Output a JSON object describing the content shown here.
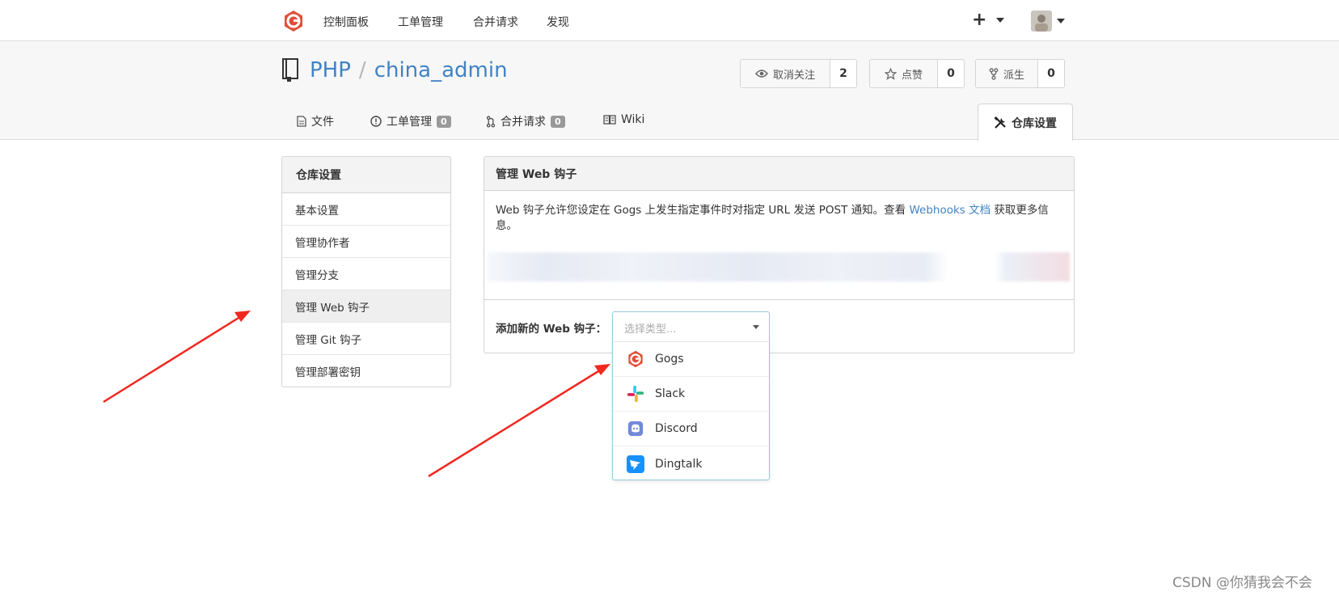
{
  "nav": {
    "items": [
      "控制面板",
      "工单管理",
      "合并请求",
      "发现"
    ],
    "plus": "+",
    "colors": {
      "logo": "#e04e39"
    }
  },
  "repo": {
    "owner": "PHP",
    "separator": "/",
    "name": "china_admin",
    "watch": {
      "label": "取消关注",
      "count": "2"
    },
    "star": {
      "label": "点赞",
      "count": "0"
    },
    "fork": {
      "label": "派生",
      "count": "0"
    }
  },
  "tabs": [
    {
      "label": "文件",
      "icon": "file-icon"
    },
    {
      "label": "工单管理",
      "icon": "issue-icon",
      "badge": "0"
    },
    {
      "label": "合并请求",
      "icon": "pull-request-icon",
      "badge": "0"
    },
    {
      "label": "Wiki",
      "icon": "book-icon"
    }
  ],
  "active_tab": {
    "label": "仓库设置",
    "icon": "tools-icon"
  },
  "sidebar": {
    "title": "仓库设置",
    "items": [
      "基本设置",
      "管理协作者",
      "管理分支",
      "管理 Web 钩子",
      "管理 Git 钩子",
      "管理部署密钥"
    ],
    "active_index": 3
  },
  "panel": {
    "title": "管理 Web 钩子",
    "desc_prefix": "Web 钩子允许您设定在 Gogs 上发生指定事件时对指定 URL 发送 POST 通知。查看 ",
    "desc_link": "Webhooks 文档",
    "desc_suffix": " 获取更多信息。",
    "add_label": "添加新的 Web 钩子："
  },
  "dropdown": {
    "placeholder": "选择类型...",
    "options": [
      "Gogs",
      "Slack",
      "Discord",
      "Dingtalk"
    ]
  },
  "watermark": "CSDN @你猜我会不会"
}
